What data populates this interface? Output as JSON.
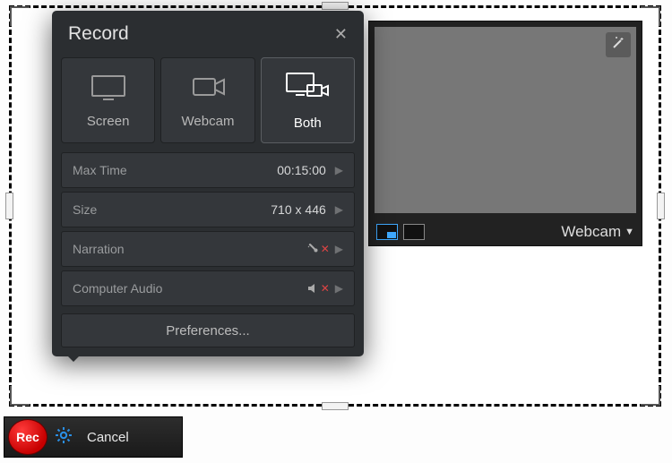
{
  "popover": {
    "title": "Record",
    "modes": {
      "screen": "Screen",
      "webcam": "Webcam",
      "both": "Both"
    },
    "settings": {
      "maxtime": {
        "label": "Max Time",
        "value": "00:15:00"
      },
      "size": {
        "label": "Size",
        "value": "710 x 446"
      },
      "narration": {
        "label": "Narration"
      },
      "compaudio": {
        "label": "Computer Audio"
      }
    },
    "preferences": "Preferences..."
  },
  "webcam": {
    "label": "Webcam"
  },
  "toolbar": {
    "rec": "Rec",
    "cancel": "Cancel"
  }
}
